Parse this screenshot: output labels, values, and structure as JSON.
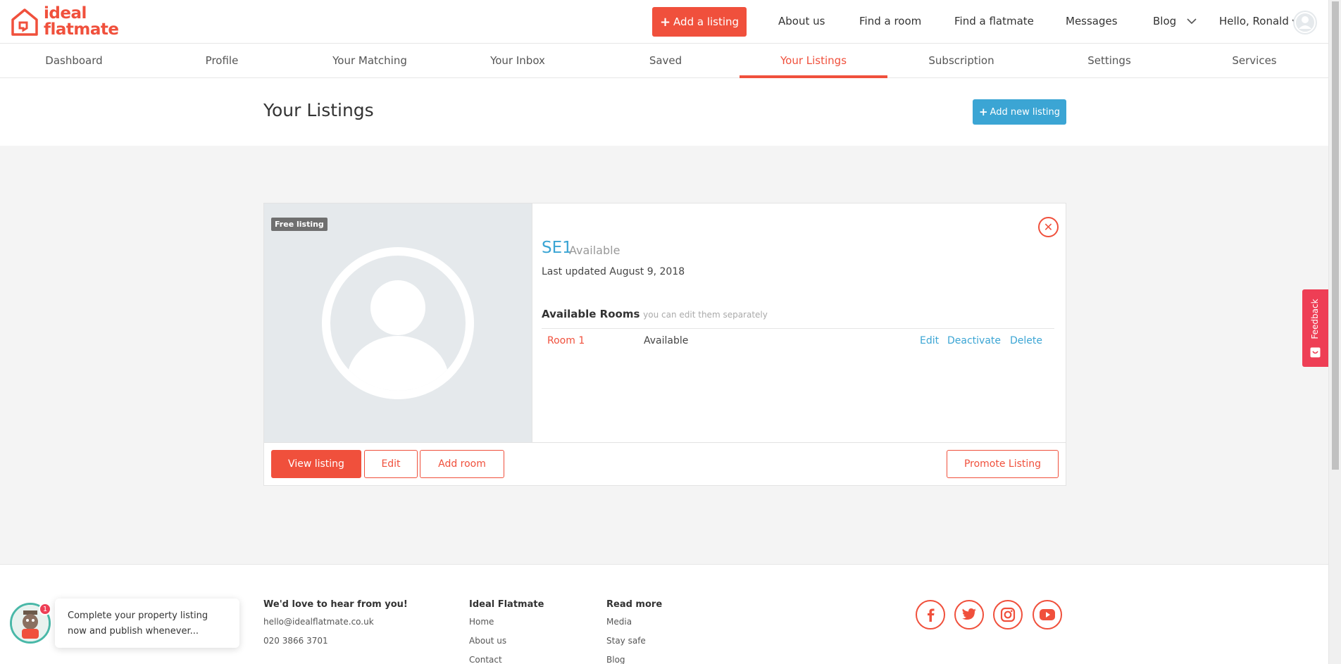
{
  "brand": {
    "line1": "ideal",
    "line2": "flatmate"
  },
  "topnav": {
    "add_listing": "Add a listing",
    "about": "About us",
    "find_room": "Find a room",
    "find_flatmate": "Find a flatmate",
    "messages": "Messages",
    "blog": "Blog",
    "greeting": "Hello, Ronald"
  },
  "subnav": [
    "Dashboard",
    "Profile",
    "Your Matching",
    "Your Inbox",
    "Saved",
    "Your Listings",
    "Subscription",
    "Settings",
    "Services"
  ],
  "page": {
    "title": "Your Listings",
    "add_new": "Add new listing"
  },
  "listing": {
    "badge": "Free listing",
    "postcode": "SE1",
    "status": "Available",
    "updated": "Last updated August 9, 2018",
    "rooms_title": "Available Rooms",
    "rooms_sub": "you can edit them separately",
    "room": {
      "name": "Room 1",
      "status": "Available",
      "edit": "Edit",
      "deactivate": "Deactivate",
      "delete": "Delete"
    },
    "actions": {
      "view": "View listing",
      "edit": "Edit",
      "add_room": "Add room",
      "promote": "Promote Listing"
    }
  },
  "feedback": "Feedback",
  "footer": {
    "contact_title": "We'd love to hear from you!",
    "email": "hello@idealflatmate.co.uk",
    "phone": "020 3866 3701",
    "col2_title": "Ideal Flatmate",
    "col2_links": [
      "Home",
      "About us",
      "Contact"
    ],
    "col3_title": "Read more",
    "col3_links": [
      "Media",
      "Stay safe",
      "Blog"
    ]
  },
  "social_icons": [
    "facebook-icon",
    "twitter-icon",
    "instagram-icon",
    "youtube-icon"
  ],
  "chat": {
    "badge": "1",
    "message": "Complete your property listing now and publish whenever..."
  },
  "colors": {
    "brand": "#f0503c",
    "accent_blue": "#3ba5d4",
    "feedback": "#ee3e55",
    "chat_ring": "#49b8a8"
  }
}
